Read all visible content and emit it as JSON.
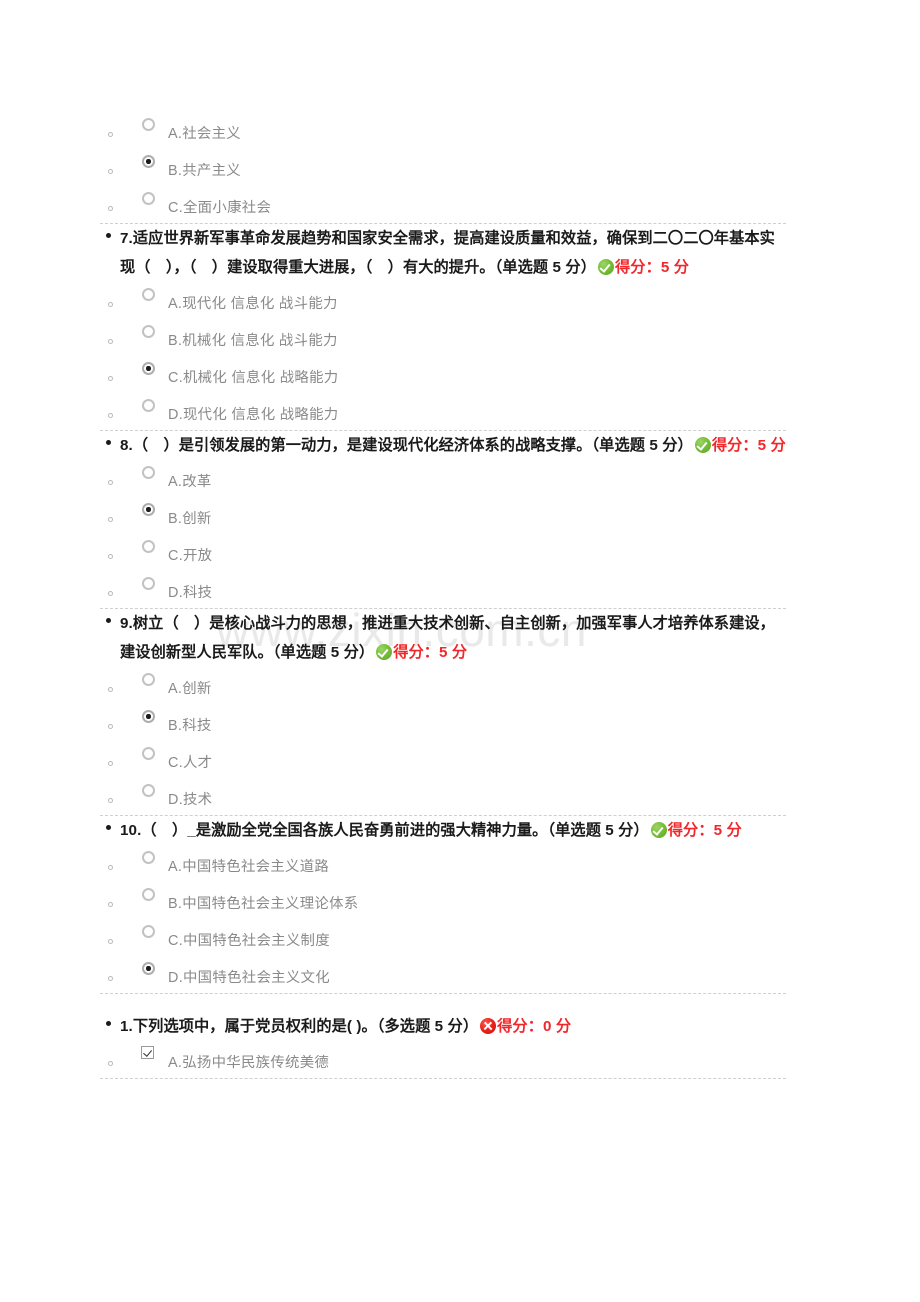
{
  "watermark": {
    "text": "www.zixin.com.cn",
    "color": "#e9e9e9"
  },
  "labels": {
    "score_prefix": "得分",
    "colon": "：",
    "unit": "分",
    "single_choice": "（单选题 5 分）",
    "multi_choice": "（多选题 5 分）"
  },
  "colors": {
    "correct": "#69b42e",
    "incorrect": "#e8201a",
    "score_text": "#f1272b",
    "option_text": "#8a8a8a",
    "question_text": "#1a1a1a"
  },
  "questions": [
    {
      "id": "q6-tail",
      "partial": true,
      "stem": "",
      "options": [
        {
          "letter": "A",
          "label": "A.社会主义",
          "type": "radio",
          "checked": false
        },
        {
          "letter": "B",
          "label": "B.共产主义",
          "type": "radio",
          "checked": true
        },
        {
          "letter": "C",
          "label": "C.全面小康社会",
          "type": "radio",
          "checked": false
        }
      ]
    },
    {
      "id": "q7",
      "partial": false,
      "stem": "7.适应世界新军事革命发展趋势和国家安全需求，提高建设质量和效益，确保到二〇二〇年基本实现（　），（　）建设取得重大进展，（　）有大的提升。（单选题 5 分）",
      "result": "correct",
      "score_text": "得分：5 分",
      "options": [
        {
          "letter": "A",
          "label": "A.现代化 信息化 战斗能力",
          "type": "radio",
          "checked": false
        },
        {
          "letter": "B",
          "label": "B.机械化 信息化 战斗能力",
          "type": "radio",
          "checked": false
        },
        {
          "letter": "C",
          "label": "C.机械化 信息化 战略能力",
          "type": "radio",
          "checked": true
        },
        {
          "letter": "D",
          "label": "D.现代化 信息化 战略能力",
          "type": "radio",
          "checked": false
        }
      ]
    },
    {
      "id": "q8",
      "partial": false,
      "stem": "8.（　）是引领发展的第一动力，是建设现代化经济体系的战略支撑。（单选题 5 分）",
      "result": "correct",
      "score_text": "得分：5 分",
      "options": [
        {
          "letter": "A",
          "label": "A.改革",
          "type": "radio",
          "checked": false
        },
        {
          "letter": "B",
          "label": "B.创新",
          "type": "radio",
          "checked": true
        },
        {
          "letter": "C",
          "label": "C.开放",
          "type": "radio",
          "checked": false
        },
        {
          "letter": "D",
          "label": "D.科技",
          "type": "radio",
          "checked": false
        }
      ]
    },
    {
      "id": "q9",
      "partial": false,
      "stem": "9.树立（　）是核心战斗力的思想，推进重大技术创新、自主创新，加强军事人才培养体系建设，建设创新型人民军队。（单选题 5 分）",
      "result": "correct",
      "score_text": "得分：5 分",
      "options": [
        {
          "letter": "A",
          "label": "A.创新",
          "type": "radio",
          "checked": false
        },
        {
          "letter": "B",
          "label": "B.科技",
          "type": "radio",
          "checked": true
        },
        {
          "letter": "C",
          "label": "C.人才",
          "type": "radio",
          "checked": false
        },
        {
          "letter": "D",
          "label": "D.技术",
          "type": "radio",
          "checked": false
        }
      ]
    },
    {
      "id": "q10",
      "partial": false,
      "stem": "10.（　）_是激励全党全国各族人民奋勇前进的强大精神力量。（单选题 5 分）",
      "result": "correct",
      "score_text": "得分：5 分",
      "options": [
        {
          "letter": "A",
          "label": "A.中国特色社会主义道路",
          "type": "radio",
          "checked": false
        },
        {
          "letter": "B",
          "label": "B.中国特色社会主义理论体系",
          "type": "radio",
          "checked": false
        },
        {
          "letter": "C",
          "label": "C.中国特色社会主义制度",
          "type": "radio",
          "checked": false
        },
        {
          "letter": "D",
          "label": "D.中国特色社会主义文化",
          "type": "radio",
          "checked": true
        }
      ]
    },
    {
      "id": "m1",
      "partial": false,
      "stem": "1.下列选项中，属于党员权利的是( )。（多选题 5 分）",
      "result": "incorrect",
      "score_text": "得分：0 分",
      "options": [
        {
          "letter": "A",
          "label": "A.弘扬中华民族传统美德",
          "type": "checkbox",
          "checked": true
        }
      ]
    }
  ]
}
